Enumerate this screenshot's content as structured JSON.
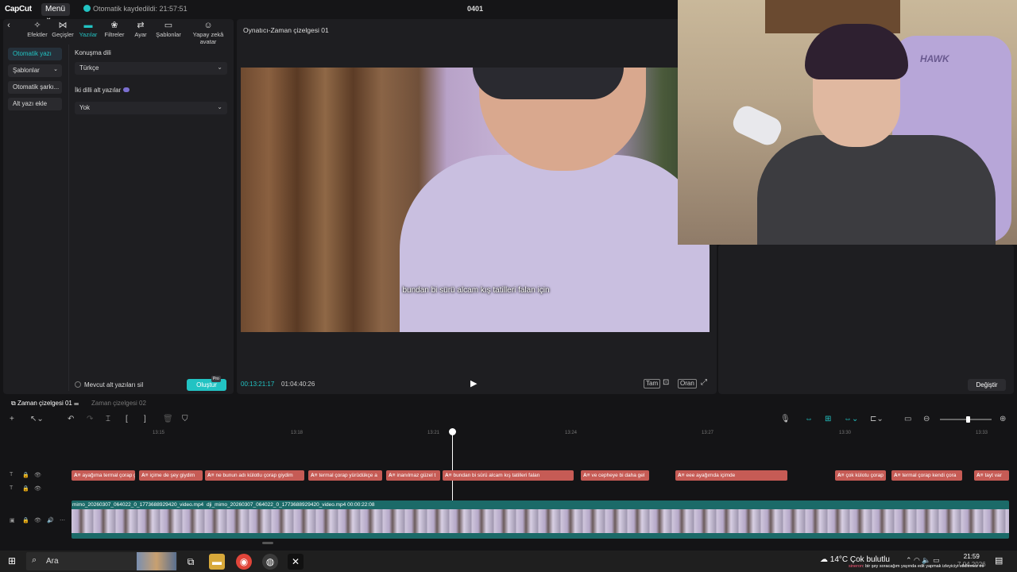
{
  "app": {
    "logo": "CapCut",
    "menu_label": "Menü ⌄",
    "autosave": "Otomatik kaydedildi: 21:57:51",
    "project_title": "0401"
  },
  "tool_tabs": [
    {
      "label": "Efektler",
      "icon": "sparkle-icon"
    },
    {
      "label": "Geçişler",
      "icon": "transition-icon"
    },
    {
      "label": "Yazılar",
      "icon": "text-icon"
    },
    {
      "label": "Filtreler",
      "icon": "filter-icon"
    },
    {
      "label": "Ayar",
      "icon": "adjust-icon"
    },
    {
      "label": "Şablonlar",
      "icon": "template-icon"
    },
    {
      "label": "Yapay zekâ avatar",
      "icon": "avatar-icon"
    }
  ],
  "subnav": [
    "Otomatik yazı",
    "Şablonlar",
    "Otomatik şarkı...",
    "Alt yazı ekle"
  ],
  "caption_panel": {
    "language_label": "Konuşma dili",
    "language_value": "Türkçe",
    "bilingual_label": "İki dilli alt yazılar",
    "bilingual_value": "Yok",
    "remove_label": "Mevcut alt yazıları sil",
    "create_label": "Oluştur",
    "pro_badge": "Pro"
  },
  "player": {
    "title": "Oynatıcı-Zaman çizelgesi 01",
    "subtitle": "bundan bi sürü alcam kış tatilleri falan için",
    "time_current": "00:13:21:17",
    "time_total": "01:04:40:26",
    "controls": [
      "Tam",
      "Oran"
    ]
  },
  "right_panel": {
    "change_label": "Değiştir"
  },
  "webcam": {
    "brand": "HAWK"
  },
  "timeline": {
    "tab_active": "Zaman çizelgesi 01",
    "tab_inactive": "Zaman çizelgesi 02",
    "ticks": [
      "13:15",
      "13:18",
      "13:21",
      "13:24",
      "13:27",
      "13:30",
      "13:33"
    ],
    "text_clips": [
      "ayağıma termal çorap gi",
      "içime de şey giydim",
      "ne bunun adı külotlu çorap giydim",
      "termal çorap yürüdükçe a",
      "inanılmaz güzel t",
      "bundan bi sürü alcam kış tatilleri falan",
      "ve cepheye bi daha gel",
      "eee ayağımda içimde",
      "çok külotu çorap",
      "termal çorap kendi çora",
      "tayt var"
    ],
    "video_label_1": "mimo_20260307_064022_0_1773688929420_video.mp4",
    "video_label_2": "dji_mimo_20260307_064022_0_1773688929420_video.mp4   00:00:22:08"
  },
  "taskbar": {
    "search_placeholder": "Ara",
    "weather": "14°C  Çok bulutlu",
    "clock_time": "21:59",
    "clock_date": "7.04.2026",
    "stream_user": "sineron",
    "stream_message": ": bir şey soracağım yayında edit yapmak izleyiciyi etkilemez mi"
  },
  "colors": {
    "accent": "#22c3c3",
    "clip": "#c65b55",
    "video_track": "#1b6a68"
  }
}
